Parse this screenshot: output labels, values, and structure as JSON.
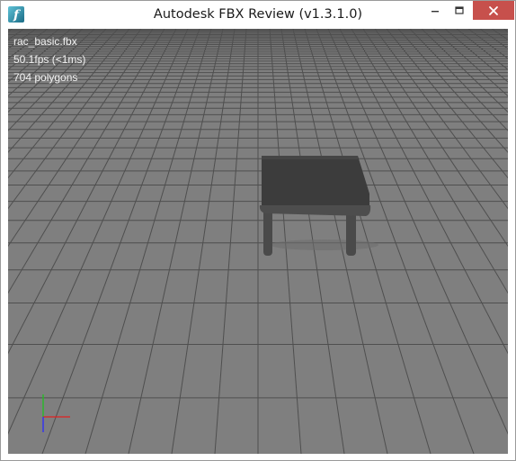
{
  "window": {
    "title": "Autodesk FBX Review (v1.3.1.0)",
    "controls": {
      "minimize_icon": "minimize-icon",
      "maximize_icon": "maximize-icon",
      "close_icon": "close-icon"
    }
  },
  "app": {
    "icon": "fbx-review-logo-icon",
    "icon_letter": "f"
  },
  "viewport": {
    "file_name": "rac_basic.fbx",
    "fps_readout": "50.1fps (<1ms)",
    "polygon_count": "704 polygons",
    "background_color": "#7f7f7f",
    "grid_color": "#4f4f4f",
    "model": "table"
  },
  "axis_colors": {
    "x": "#e02020",
    "y": "#20c020",
    "z": "#2a2aff"
  }
}
